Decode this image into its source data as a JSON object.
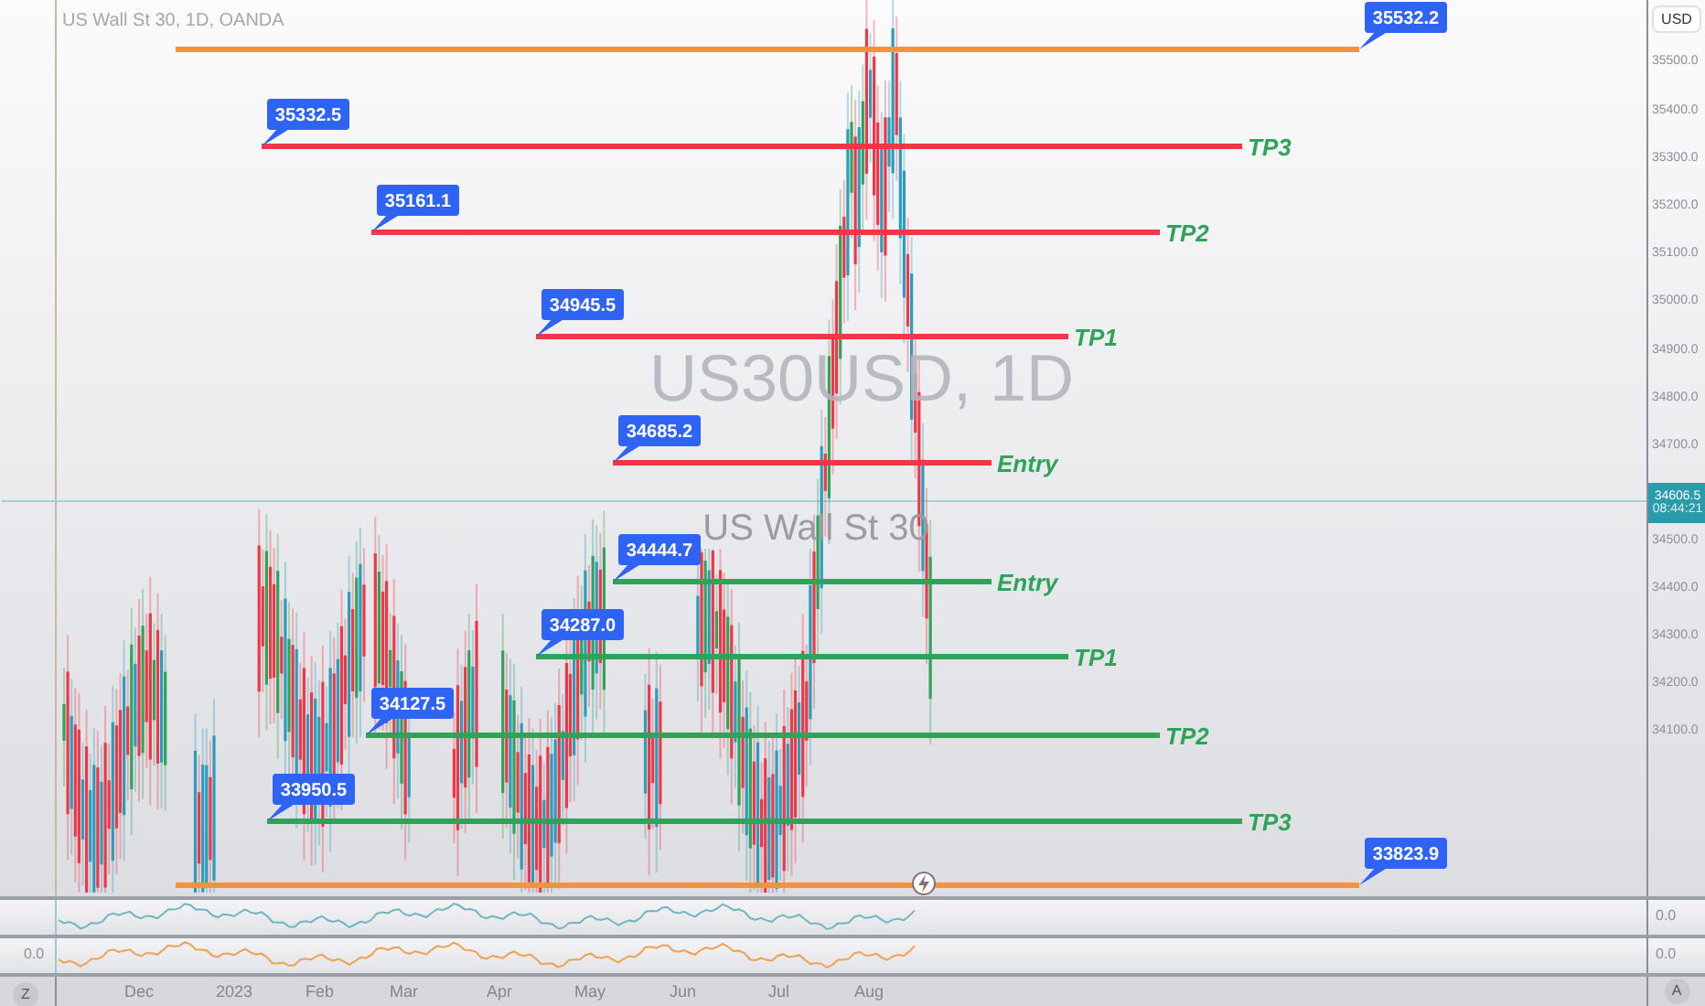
{
  "header": {
    "title": "US Wall St 30, 1D, OANDA"
  },
  "watermark": {
    "symbol": "US30USD, 1D",
    "name": "US Wall St 30"
  },
  "currency_button": "USD",
  "levels": [
    {
      "kind": "marker",
      "price": "35532.2",
      "color": "#f7923a"
    },
    {
      "kind": "target",
      "price": "35332.5",
      "color": "#f23645",
      "tag": "TP3"
    },
    {
      "kind": "target",
      "price": "35161.1",
      "color": "#f23645",
      "tag": "TP2"
    },
    {
      "kind": "target",
      "price": "34945.5",
      "color": "#f23645",
      "tag": "TP1"
    },
    {
      "kind": "target",
      "price": "34685.2",
      "color": "#f23645",
      "tag": "Entry"
    },
    {
      "kind": "target",
      "price": "34444.7",
      "color": "#2ea35a",
      "tag": "Entry"
    },
    {
      "kind": "target",
      "price": "34287.0",
      "color": "#2ea35a",
      "tag": "TP1"
    },
    {
      "kind": "target",
      "price": "34127.5",
      "color": "#2ea35a",
      "tag": "TP2"
    },
    {
      "kind": "target",
      "price": "33950.5",
      "color": "#2ea35a",
      "tag": "TP3"
    },
    {
      "kind": "marker",
      "price": "33823.9",
      "color": "#f7923a"
    }
  ],
  "price_axis": [
    "35500.0",
    "35400.0",
    "35300.0",
    "35200.0",
    "35100.0",
    "35000.0",
    "34900.0",
    "34800.0",
    "34700.0",
    "34500.0",
    "34400.0",
    "34300.0",
    "34200.0",
    "34100.0"
  ],
  "current_price": {
    "price": "34606.5",
    "countdown": "08:44:21"
  },
  "indicator_panes": [
    {
      "color": "#6fb6c0",
      "axis_value": "0.0"
    },
    {
      "color": "#f0a050",
      "axis_value": "0.0",
      "side_value": "0.0"
    }
  ],
  "time_axis": [
    "Dec",
    "2023",
    "Feb",
    "Mar",
    "Apr",
    "May",
    "Jun",
    "Jul",
    "Aug"
  ],
  "corner_buttons": {
    "left": "Z",
    "right": "A"
  }
}
